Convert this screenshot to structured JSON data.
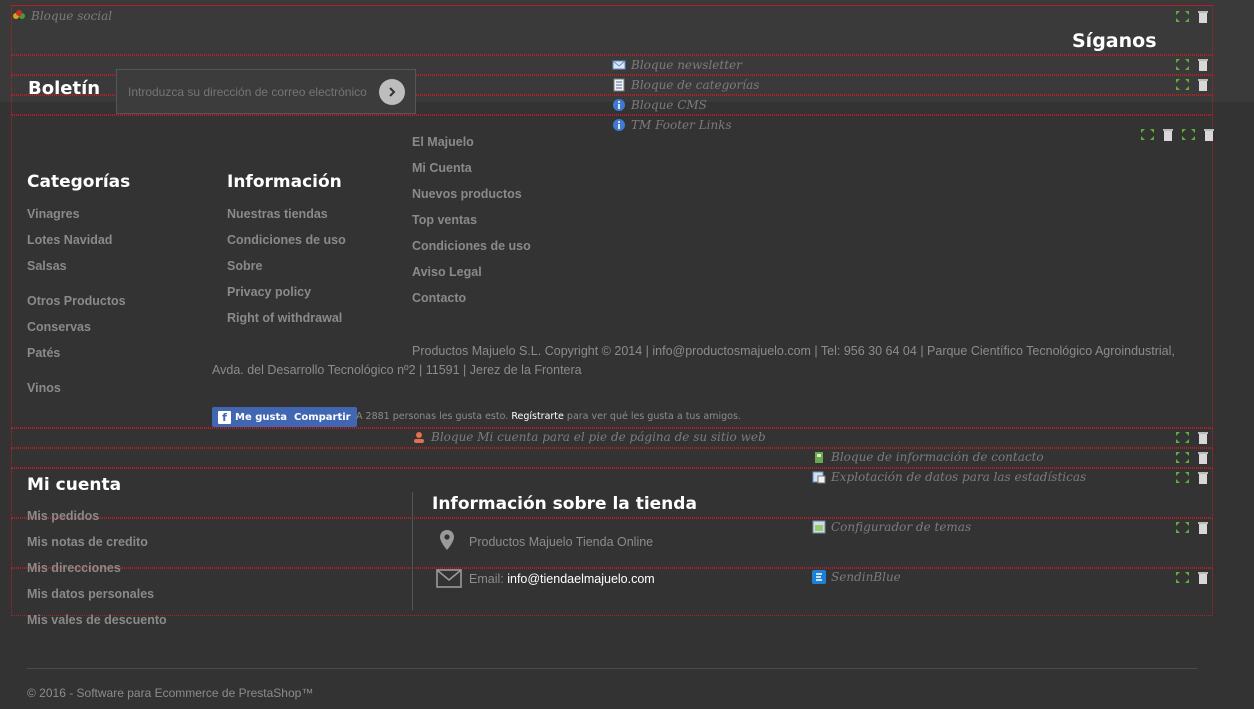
{
  "modules": {
    "social": "Bloque social",
    "newsletter": "Bloque newsletter",
    "categories": "Bloque de categorías",
    "cms": "Bloque CMS",
    "footer_links": "TM Footer Links",
    "myaccount_footer": "Bloque Mi cuenta para el pie de página de su sitio web",
    "contact_info": "Bloque de información de contacto",
    "stats": "Explotación de datos para las estadísticas",
    "theme_config": "Configurador de temas",
    "sendinblue": "SendinBlue"
  },
  "social": {
    "heading": "Síganos"
  },
  "newsletter": {
    "heading": "Boletín",
    "placeholder": "Introduzca su dirección de correo electrónico"
  },
  "categories": {
    "heading": "Categorías",
    "items": [
      "Vinagres",
      "Lotes Navidad",
      "Salsas",
      "Otros Productos",
      "Conservas",
      "Patés",
      "Vinos"
    ]
  },
  "info": {
    "heading": "Información",
    "items": [
      "Nuestras tiendas",
      "Condiciones de uso",
      "Sobre",
      "Privacy policy",
      "Right of withdrawal"
    ]
  },
  "footer_links": {
    "items": [
      "El Majuelo",
      "Mi Cuenta",
      "Nuevos productos",
      "Top ventas",
      "Condiciones de uso",
      "Aviso Legal",
      "Contacto"
    ]
  },
  "copyright": {
    "line1": "Productos Majuelo S.L. Copyright © 2014 | info@productosmajuelo.com | Tel: 956 30 64 04 | Parque Científico Tecnológico Agroindustrial,",
    "line2": "Avda. del Desarrollo Tecnológico nº2 | 11591 | Jerez de la Frontera"
  },
  "facebook": {
    "like": "Me gusta",
    "share": "Compartir",
    "count_text": "A 2881 personas les gusta esto.",
    "register": "Regístrarte",
    "rest": "para ver qué les gusta a tus amigos."
  },
  "my_account": {
    "heading": "Mi cuenta",
    "items": [
      "Mis pedidos",
      "Mis notas de credito",
      "Mis direcciones",
      "Mis datos personales",
      "Mis vales de descuento"
    ]
  },
  "store_info": {
    "heading": "Información sobre la tienda",
    "name": "Productos Majuelo Tienda Online",
    "email_label": "Email:",
    "email": "info@tiendaelmajuelo.com"
  },
  "footer": {
    "copyright": "© 2016 - Software para Ecommerce de PrestaShop™"
  },
  "colors": {
    "background": "#333333",
    "outline": "#b3202a",
    "heading": "#ffffff",
    "link": "#8a8a8a",
    "facebook": "#4267b2"
  }
}
